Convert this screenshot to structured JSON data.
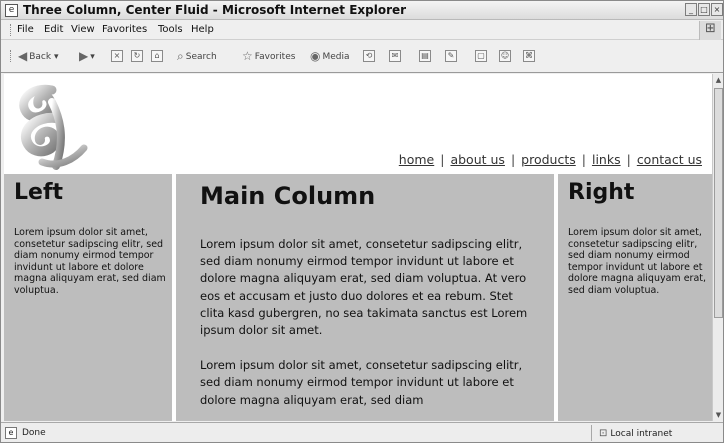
{
  "window": {
    "title": "Three Column, Center Fluid - Microsoft Internet Explorer"
  },
  "menu": [
    "File",
    "Edit",
    "View",
    "Favorites",
    "Tools",
    "Help"
  ],
  "toolbar": {
    "back": "Back",
    "search": "Search",
    "favorites": "Favorites",
    "media": "Media"
  },
  "page": {
    "nav": [
      "home",
      "about us",
      "products",
      "links",
      "contact us"
    ],
    "nav_separator": "|",
    "left": {
      "heading": "Left",
      "text": "Lorem ipsum dolor sit amet, consetetur sadipscing elitr, sed diam nonumy eirmod tempor invidunt ut labore et dolore magna aliquyam erat, sed diam voluptua."
    },
    "main": {
      "heading": "Main Column",
      "p1": "Lorem ipsum dolor sit amet, consetetur sadipscing elitr, sed diam nonumy eirmod tempor invidunt ut labore et dolore magna aliquyam erat, sed diam voluptua. At vero eos et accusam et justo duo dolores et ea rebum. Stet clita kasd gubergren, no sea takimata sanctus est Lorem ipsum dolor sit amet.",
      "p2": "Lorem ipsum dolor sit amet, consetetur sadipscing elitr, sed diam nonumy eirmod tempor invidunt ut labore et dolore magna aliquyam erat, sed diam"
    },
    "right": {
      "heading": "Right",
      "text": "Lorem ipsum dolor sit amet, consetetur sadipscing elitr, sed diam nonumy eirmod tempor invidunt ut labore et dolore magna aliquyam erat, sed diam voluptua."
    }
  },
  "status": {
    "text": "Done",
    "zone": "Local intranet"
  },
  "colors": {
    "column_bg": "#bdbdbd",
    "page_bg": "#ffffff",
    "chrome_bg": "#efefef"
  }
}
